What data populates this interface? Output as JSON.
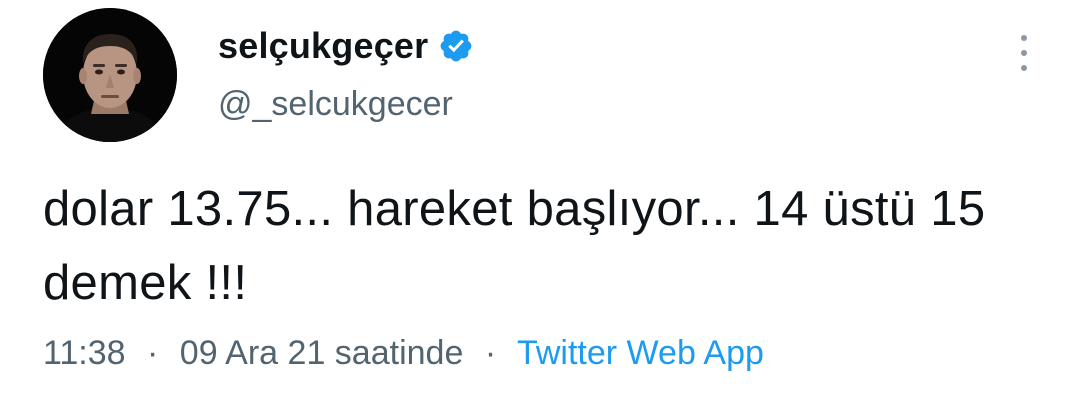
{
  "author": {
    "display_name": "selçukgeçer",
    "handle": "@_selcukgecer",
    "verified_icon": "verified-badge-icon",
    "avatar_icon": "profile-photo"
  },
  "more_icon": "vertical-ellipsis-icon",
  "tweet": {
    "text": "dolar 13.75... hareket başlıyor... 14 üstü 15 demek !!!",
    "time": "11:38",
    "date": "09 Ara 21 saatinde",
    "separator": "·",
    "source": "Twitter Web App"
  },
  "colors": {
    "text": "#0f1419",
    "secondary": "#536471",
    "accent": "#1d9bf0",
    "background": "#ffffff"
  }
}
